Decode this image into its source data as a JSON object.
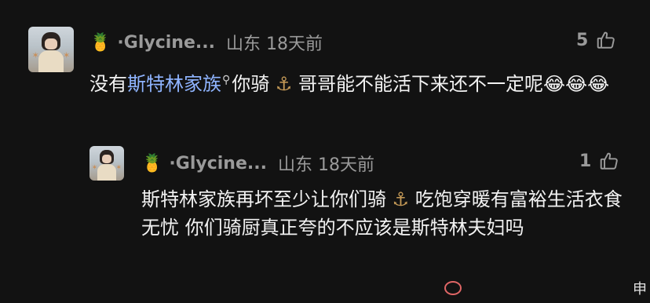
{
  "comments": [
    {
      "username": "·Glycine...",
      "username_icon": "pineapple-icon",
      "location": "山东 18天前",
      "likes": "5",
      "text_before": "没有",
      "link_text": "斯特林家族",
      "text_after_link": "你骑",
      "text_after_hook": "哥哥能不能活下来还不一定呢",
      "emojis": "😂😂😂"
    },
    {
      "username": "·Glycine...",
      "username_icon": "pineapple-icon",
      "location": "山东 18天前",
      "likes": "1",
      "text_before_hook": "斯特林家族再坏至少让你们骑",
      "text_after_hook": "吃饱穿暖有富裕生活衣食无忧 你们骑厨真正夸的不应该是斯特林夫妇吗"
    }
  ],
  "watermark": {
    "edge_char": "申"
  },
  "colors": {
    "background": "#121212",
    "link": "#8fb4ff",
    "meta": "#9a9a9a"
  }
}
